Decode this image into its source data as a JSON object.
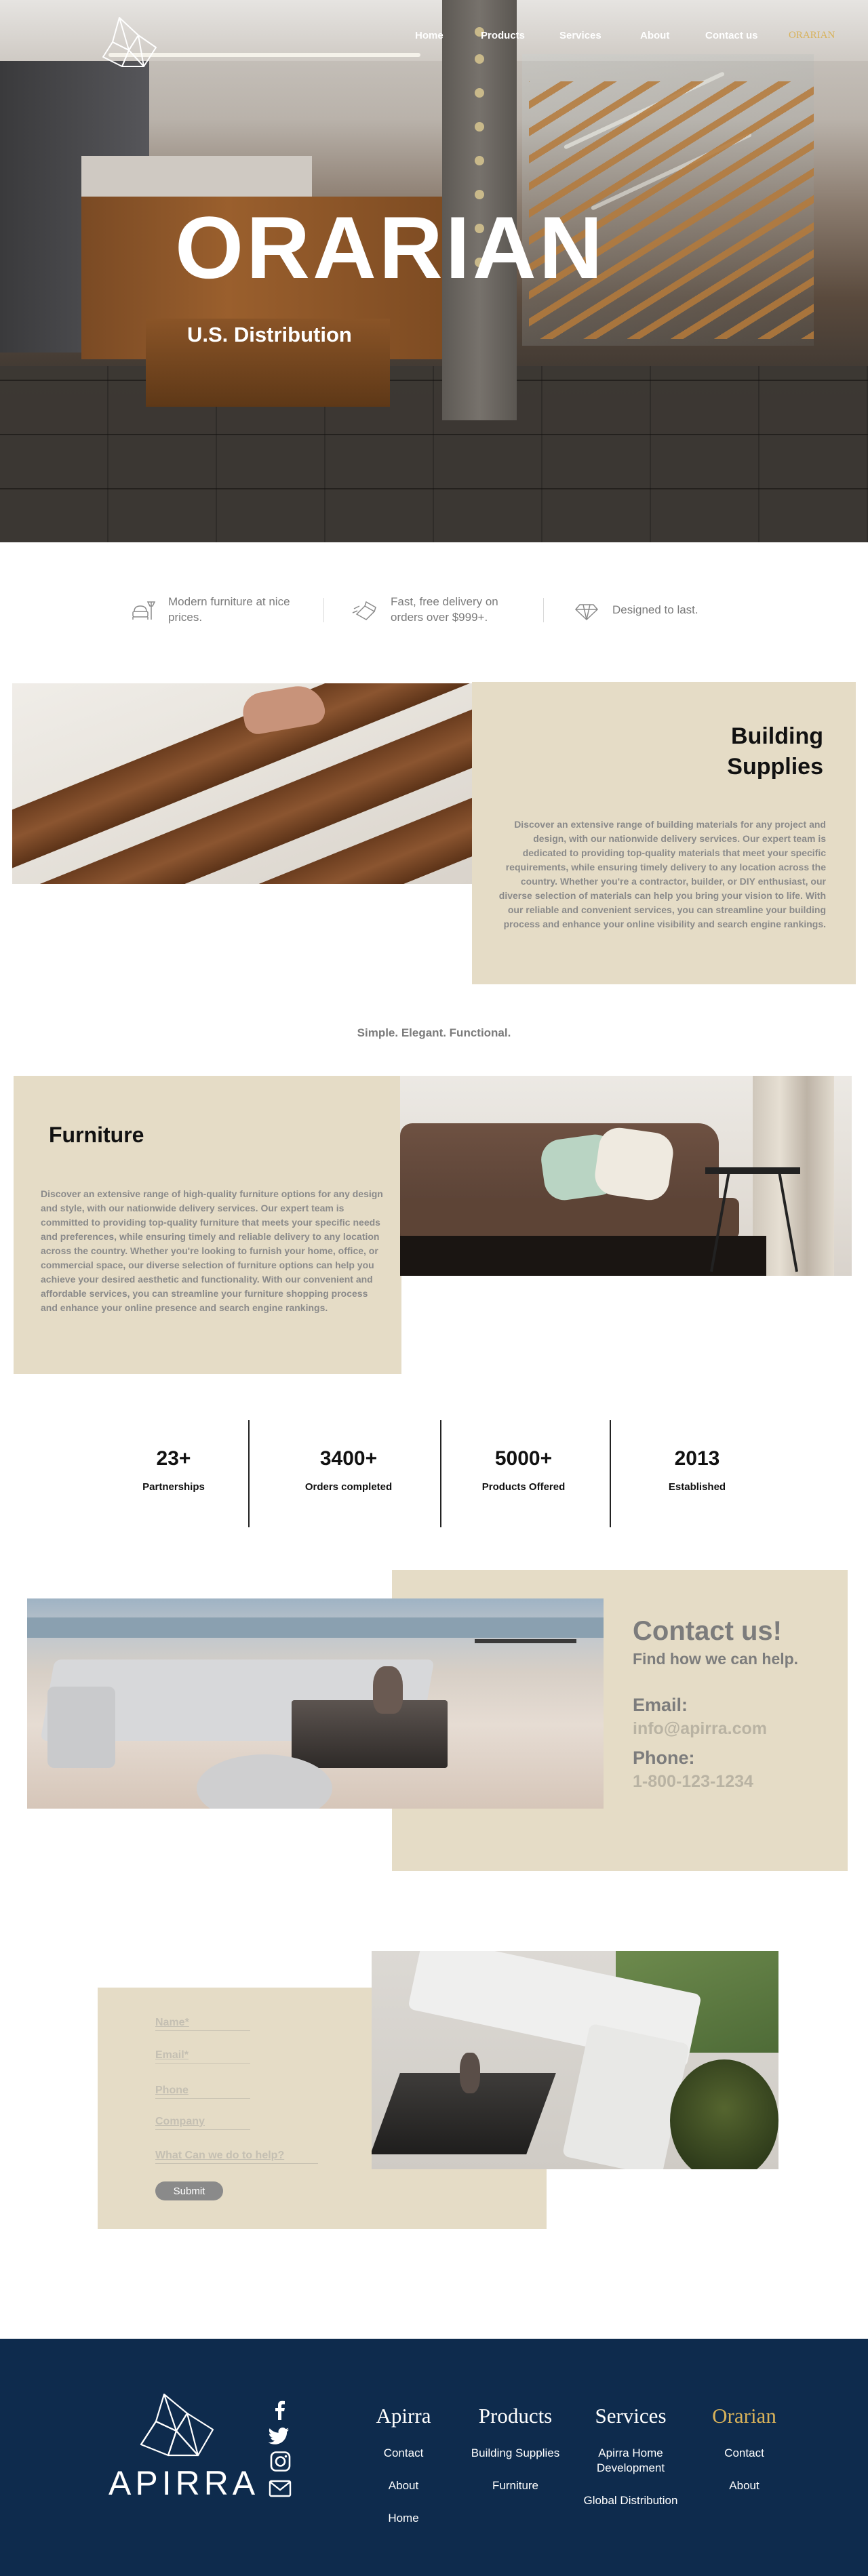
{
  "colors": {
    "panel_beige": "#e5dcc6",
    "footer_navy": "#0e2b4d",
    "gold_accent": "#d8b25a",
    "muted_text": "#7b7b7b"
  },
  "nav": {
    "items": [
      {
        "label": "Home"
      },
      {
        "label": "Products"
      },
      {
        "label": "Services"
      },
      {
        "label": "About"
      },
      {
        "label": "Contact us"
      },
      {
        "label": "ORARIAN"
      }
    ]
  },
  "hero": {
    "title": "ORARIAN",
    "subtitle": "U.S. Distribution"
  },
  "features": [
    {
      "icon": "sofa-lamp-icon",
      "text": "Modern furniture at nice prices."
    },
    {
      "icon": "delivery-box-icon",
      "text": "Fast, free delivery on orders over $999+."
    },
    {
      "icon": "diamond-icon",
      "text": "Designed to last."
    }
  ],
  "building": {
    "title_line1": "Building",
    "title_line2": "Supplies",
    "body": "Discover an extensive range of building materials for any project and design, with our nationwide delivery services. Our expert team is dedicated to providing top-quality materials that meet your specific requirements, while ensuring timely delivery to any location across the country. Whether you're a contractor, builder, or DIY enthusiast, our diverse selection of materials can help you bring your vision to life. With our reliable and convenient services, you can streamline your building process and enhance your online visibility and search engine rankings."
  },
  "tagline": "Simple. Elegant. Functional.",
  "furniture": {
    "title": "Furniture",
    "body": "Discover an extensive range of high-quality furniture options for any design and style, with our nationwide delivery services. Our expert team is committed to providing top-quality furniture that meets your specific needs and preferences, while ensuring timely and reliable delivery to any location across the country. Whether you're looking to furnish your home, office, or commercial space, our diverse selection of furniture options can help you achieve your desired aesthetic and functionality. With our convenient and affordable services, you can streamline your furniture shopping process and enhance your online presence and search engine rankings."
  },
  "stats": [
    {
      "value": "23+",
      "label": "Partnerships"
    },
    {
      "value": "3400+",
      "label": "Orders completed"
    },
    {
      "value": "5000+",
      "label": "Products Offered"
    },
    {
      "value": "2013",
      "label": "Established"
    }
  ],
  "contact": {
    "title": "Contact us!",
    "subtitle": "Find how we can help.",
    "email_label": "Email:",
    "email_value": "info@apirra.com",
    "phone_label": "Phone:",
    "phone_value": "1-800-123-1234"
  },
  "form": {
    "name_placeholder": "Name*",
    "email_placeholder": "Email*",
    "phone_placeholder": "Phone",
    "company_placeholder": "Company",
    "help_placeholder": "What Can we do to help?",
    "submit_label": "Submit"
  },
  "footer": {
    "wordmark": "APIRRA",
    "social": [
      "facebook-icon",
      "twitter-icon",
      "instagram-icon",
      "mail-icon"
    ],
    "columns": [
      {
        "heading": "Apirra",
        "links": [
          "Contact",
          "About",
          "Home"
        ]
      },
      {
        "heading": "Products",
        "links": [
          "Building Supplies",
          "Furniture"
        ]
      },
      {
        "heading": "Services",
        "links": [
          "Apirra Home Development",
          "Global Distribution"
        ]
      },
      {
        "heading": "Orarian",
        "links": [
          "Contact",
          "About"
        ]
      }
    ]
  }
}
